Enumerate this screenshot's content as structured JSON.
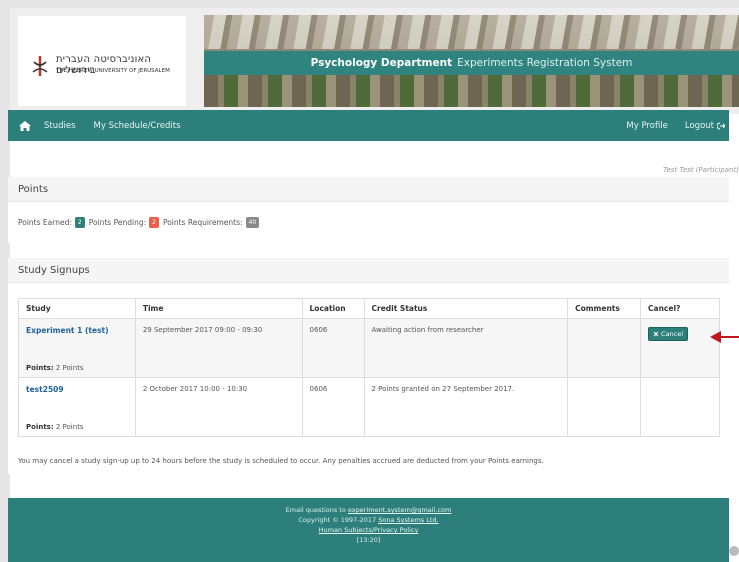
{
  "logo": {
    "hebrew": "האוניברסיטה העברית בירושלים",
    "english": "THE HEBREW UNIVERSITY OF JERUSALEM"
  },
  "banner": {
    "title_bold": "Psychology Department",
    "title_light": "Experiments Registration System"
  },
  "nav": {
    "studies": "Studies",
    "schedule": "My Schedule/Credits",
    "profile": "My Profile",
    "logout": "Logout"
  },
  "user": {
    "label": "Test Test (Participant)"
  },
  "points": {
    "heading": "Points",
    "earned_label": "Points Earned:",
    "earned_value": "2",
    "pending_label": "Points Pending:",
    "pending_value": "2",
    "required_label": "Points Requirements:",
    "required_value": "40"
  },
  "signups": {
    "heading": "Study Signups",
    "columns": [
      "Study",
      "Time",
      "Location",
      "Credit Status",
      "Comments",
      "Cancel?"
    ],
    "rows": [
      {
        "study": "Experiment 1 (test)",
        "points_label": "Points:",
        "points_value": "2 Points",
        "time": "29 September 2017 09:00 - 09:30",
        "location": "0606",
        "credit_status": "Awaiting action from researcher",
        "comments": "",
        "cancel_label": "Cancel"
      },
      {
        "study": "test2509",
        "points_label": "Points:",
        "points_value": "2 Points",
        "time": "2 October 2017 10:00 - 10:30",
        "location": "0606",
        "credit_status": "2 Points granted on 27 September 2017.",
        "comments": "",
        "cancel_label": ""
      }
    ],
    "note": "You may cancel a study sign-up up to 24 hours before the study is scheduled to occur. Any penalties accrued are deducted from your Points earnings."
  },
  "footer": {
    "email_prefix": "Email questions to",
    "email": "experiment.system@gmail.com",
    "copyright_prefix": "Copyright © 1997-2017",
    "copyright_link": "Sona Systems Ltd.",
    "privacy": "Human Subjects/Privacy Policy",
    "time": "[13:20]"
  },
  "colors": {
    "primary": "#2d7f7b",
    "link": "#1f5f9c",
    "pending_badge": "#e8604a",
    "required_badge": "#8a8a8a",
    "arrow": "#c0161f"
  },
  "icons": {
    "home": "home-icon",
    "logout": "logout-icon",
    "cancel": "x-icon",
    "pointer": "red-arrow-icon"
  }
}
